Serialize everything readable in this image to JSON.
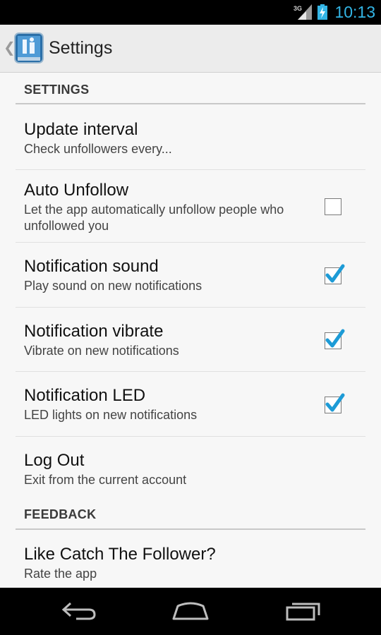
{
  "status_bar": {
    "network": "3G",
    "time": "10:13"
  },
  "action_bar": {
    "title": "Settings"
  },
  "sections": [
    {
      "header": "SETTINGS",
      "items": [
        {
          "title": "Update interval",
          "summary": "Check unfollowers every...",
          "checkbox": null
        },
        {
          "title": "Auto Unfollow",
          "summary": "Let the app automatically unfollow people who unfollowed you",
          "checkbox": false
        },
        {
          "title": "Notification sound",
          "summary": "Play sound on new notifications",
          "checkbox": true
        },
        {
          "title": "Notification vibrate",
          "summary": "Vibrate on new notifications",
          "checkbox": true
        },
        {
          "title": "Notification LED",
          "summary": "LED lights on new notifications",
          "checkbox": true
        },
        {
          "title": "Log Out",
          "summary": "Exit from the current account",
          "checkbox": null
        }
      ]
    },
    {
      "header": "FEEDBACK",
      "items": [
        {
          "title": "Like Catch The Follower?",
          "summary": "Rate the app",
          "checkbox": null
        }
      ]
    }
  ],
  "colors": {
    "accent": "#33b5e5",
    "check": "#1d9bd6",
    "background": "#f7f7f7"
  }
}
